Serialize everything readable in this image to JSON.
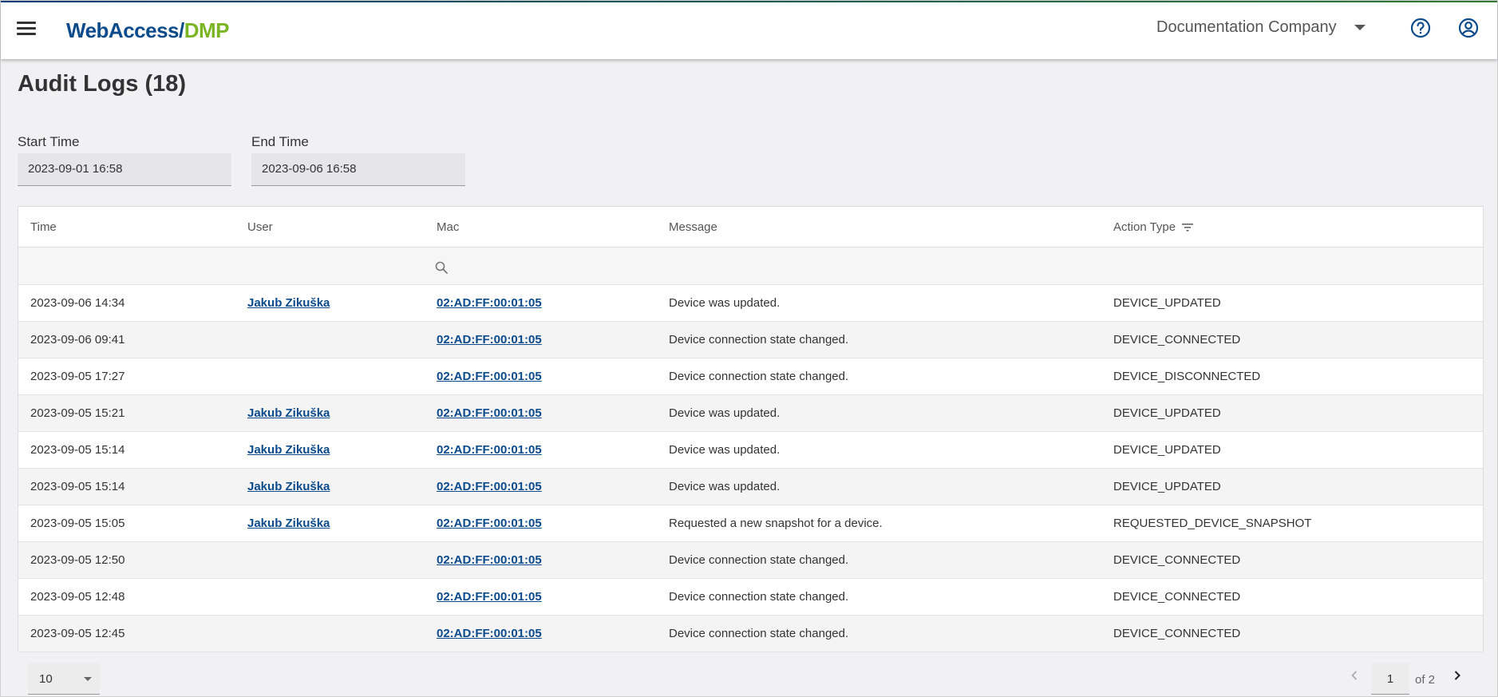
{
  "header": {
    "logo_part1": "WebAccess/",
    "logo_part2": "DMP",
    "company": "Documentation Company"
  },
  "page": {
    "title": "Audit Logs (18)"
  },
  "filters": {
    "start_label": "Start Time",
    "start_value": "2023-09-01 16:58",
    "end_label": "End Time",
    "end_value": "2023-09-06 16:58"
  },
  "table": {
    "columns": [
      "Time",
      "User",
      "Mac",
      "Message",
      "Action Type"
    ],
    "rows": [
      {
        "time": "2023-09-06 14:34",
        "user": "Jakub Zikuška",
        "mac": "02:AD:FF:00:01:05",
        "message": "Device was updated.",
        "action": "DEVICE_UPDATED"
      },
      {
        "time": "2023-09-06 09:41",
        "user": "",
        "mac": "02:AD:FF:00:01:05",
        "message": "Device connection state changed.",
        "action": "DEVICE_CONNECTED"
      },
      {
        "time": "2023-09-05 17:27",
        "user": "",
        "mac": "02:AD:FF:00:01:05",
        "message": "Device connection state changed.",
        "action": "DEVICE_DISCONNECTED"
      },
      {
        "time": "2023-09-05 15:21",
        "user": "Jakub Zikuška",
        "mac": "02:AD:FF:00:01:05",
        "message": "Device was updated.",
        "action": "DEVICE_UPDATED"
      },
      {
        "time": "2023-09-05 15:14",
        "user": "Jakub Zikuška",
        "mac": "02:AD:FF:00:01:05",
        "message": "Device was updated.",
        "action": "DEVICE_UPDATED"
      },
      {
        "time": "2023-09-05 15:14",
        "user": "Jakub Zikuška",
        "mac": "02:AD:FF:00:01:05",
        "message": "Device was updated.",
        "action": "DEVICE_UPDATED"
      },
      {
        "time": "2023-09-05 15:05",
        "user": "Jakub Zikuška",
        "mac": "02:AD:FF:00:01:05",
        "message": "Requested a new snapshot for a device.",
        "action": "REQUESTED_DEVICE_SNAPSHOT"
      },
      {
        "time": "2023-09-05 12:50",
        "user": "",
        "mac": "02:AD:FF:00:01:05",
        "message": "Device connection state changed.",
        "action": "DEVICE_CONNECTED"
      },
      {
        "time": "2023-09-05 12:48",
        "user": "",
        "mac": "02:AD:FF:00:01:05",
        "message": "Device connection state changed.",
        "action": "DEVICE_CONNECTED"
      },
      {
        "time": "2023-09-05 12:45",
        "user": "",
        "mac": "02:AD:FF:00:01:05",
        "message": "Device connection state changed.",
        "action": "DEVICE_CONNECTED"
      }
    ]
  },
  "pagination": {
    "page_size": "10",
    "current_page": "1",
    "of_label": "of 2"
  },
  "icons": {
    "menu": "menu-icon",
    "help": "help-circle-icon",
    "account": "account-circle-icon",
    "filter": "filter-icon",
    "search": "search-icon",
    "prev": "chevron-left-icon",
    "next": "chevron-right-icon"
  },
  "colors": {
    "link": "#0b4a8b",
    "logo_blue": "#0b4a8b",
    "logo_green": "#7bb524"
  }
}
